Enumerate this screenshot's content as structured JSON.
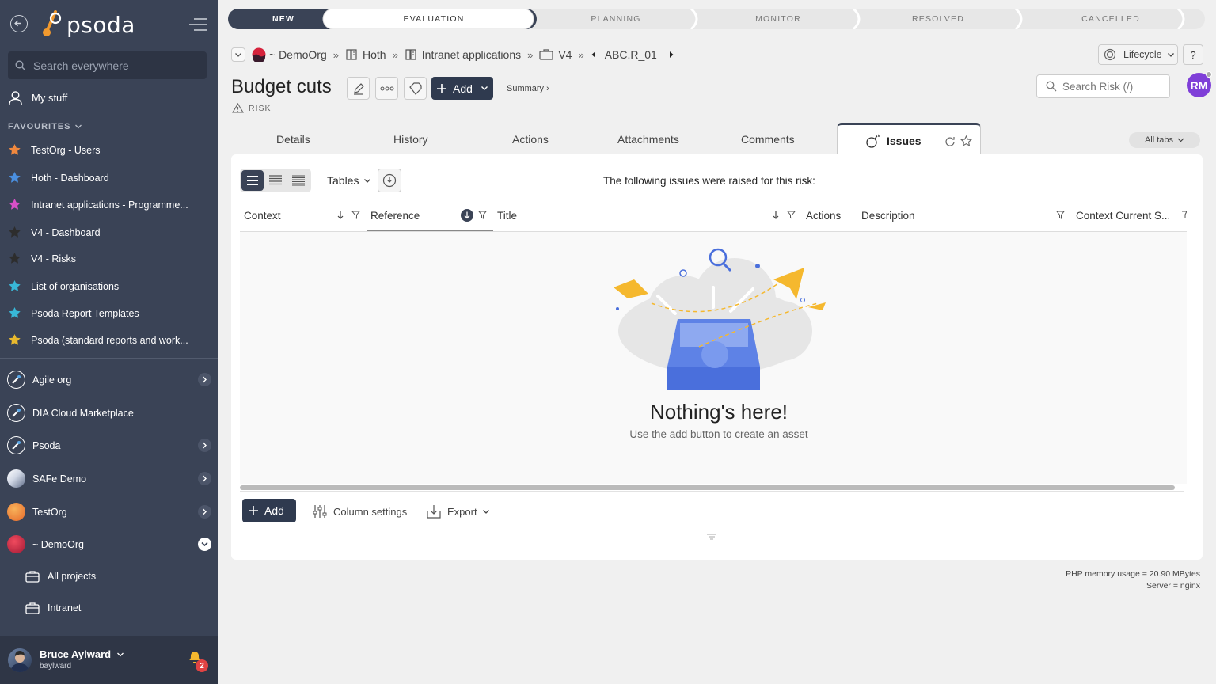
{
  "app": {
    "logo_text": "psoda"
  },
  "sidebar": {
    "search_placeholder": "Search everywhere",
    "my_stuff": "My stuff",
    "favourites_heading": "FAVOURITES",
    "favourites": [
      {
        "label": "TestOrg - Users",
        "color": "#f0883e"
      },
      {
        "label": "Hoth - Dashboard",
        "color": "#4a8fe0"
      },
      {
        "label": "Intranet applications - Programme...",
        "color": "#d94fc7"
      },
      {
        "label": "V4 - Dashboard",
        "color": "#2d2d2d"
      },
      {
        "label": "V4 - Risks",
        "color": "#2d2d2d"
      },
      {
        "label": "List of organisations",
        "color": "#38b8d8"
      },
      {
        "label": "Psoda Report Templates",
        "color": "#38b8d8"
      },
      {
        "label": "Psoda (standard reports and work...",
        "color": "#e8b92e"
      }
    ],
    "orgs": [
      {
        "label": "Agile org",
        "expandable": true
      },
      {
        "label": "DIA Cloud Marketplace",
        "expandable": false
      },
      {
        "label": "Psoda",
        "expandable": true
      },
      {
        "label": "SAFe Demo",
        "expandable": true
      },
      {
        "label": "TestOrg",
        "expandable": true
      },
      {
        "label": "~ DemoOrg",
        "expandable": true,
        "open": true
      }
    ],
    "sub_items": [
      {
        "label": "All projects"
      },
      {
        "label": "Intranet"
      }
    ],
    "user": {
      "name": "Bruce Aylward",
      "username": "baylward",
      "notifications": "2"
    }
  },
  "lifecycle": {
    "stages": [
      "NEW",
      "EVALUATION",
      "PLANNING",
      "MONITOR",
      "RESOLVED",
      "CANCELLED"
    ],
    "current": "NEW"
  },
  "breadcrumb": {
    "items": [
      "~ DemoOrg",
      "Hoth",
      "Intranet applications",
      "V4",
      "ABC.R_01"
    ]
  },
  "header": {
    "lifecycle_btn": "Lifecycle",
    "help_btn": "?",
    "title": "Budget cuts",
    "add_label": "Add",
    "summary_label": "Summary ›",
    "type_label": "RISK",
    "search_placeholder": "Search Risk (/)",
    "avatar_initials": "RM"
  },
  "tabs": {
    "items": [
      "Details",
      "History",
      "Actions",
      "Attachments",
      "Comments"
    ],
    "active": "Issues",
    "all_tabs": "All tabs"
  },
  "table": {
    "tables_label": "Tables",
    "message": "The following issues were raised for this risk:",
    "columns": [
      "Context",
      "Reference",
      "Title",
      "Actions",
      "Description",
      "Context Current S..."
    ],
    "empty_title": "Nothing's here!",
    "empty_subtitle": "Use the add button to create an asset",
    "add_label": "Add",
    "column_settings": "Column settings",
    "export_label": "Export"
  },
  "footer": {
    "memory": "PHP memory usage = 20.90 MBytes",
    "server": "Server = nginx"
  }
}
